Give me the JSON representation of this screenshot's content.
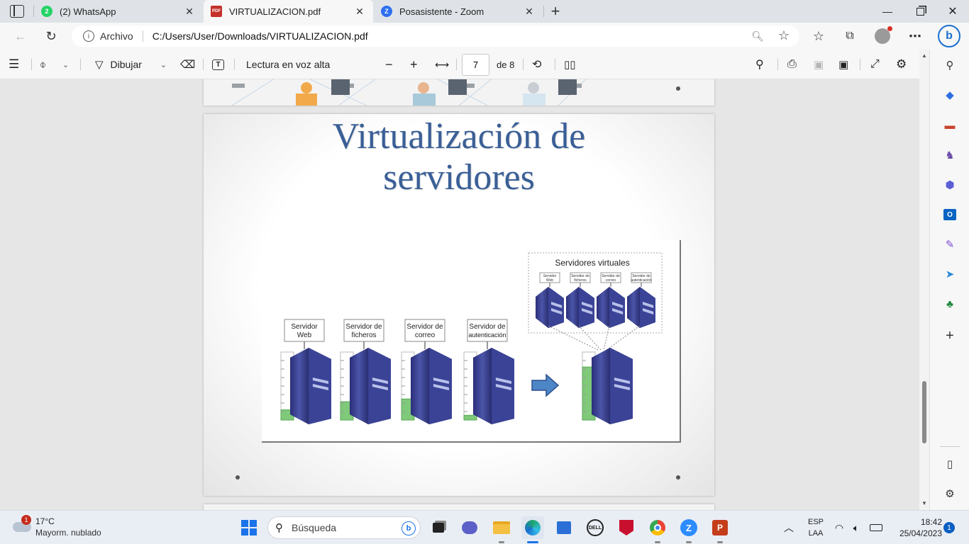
{
  "tabs": [
    {
      "title": "(2) WhatsApp",
      "badge": "2",
      "active": false
    },
    {
      "title": "VIRTUALIZACION.pdf",
      "badge": "PDF",
      "active": true
    },
    {
      "title": "Posasistente - Zoom",
      "badge": "Z",
      "active": false
    }
  ],
  "address": {
    "scheme_label": "Archivo",
    "url": "C:/Users/User/Downloads/VIRTUALIZACION.pdf"
  },
  "pdf_toolbar": {
    "draw_label": "Dibujar",
    "read_aloud_label": "Lectura en voz alta",
    "page_current": "7",
    "page_total_label": "de 8"
  },
  "slide": {
    "title_line1": "Virtualización de",
    "title_line2": "servidores",
    "virtual_group_label": "Servidores virtuales",
    "virtual_servers": [
      "Servidor Web",
      "Servidor de ficheros",
      "Servidor de correo",
      "Servidor de autenticación"
    ],
    "physical_servers": [
      {
        "label_line1": "Servidor",
        "label_line2": "Web",
        "usage": 0.15
      },
      {
        "label_line1": "Servidor de",
        "label_line2": "ficheros",
        "usage": 0.27
      },
      {
        "label_line1": "Servidor de",
        "label_line2": "correo",
        "usage": 0.31
      },
      {
        "label_line1": "Servidor de",
        "label_line2": "autenticación",
        "usage": 0.07
      }
    ],
    "consolidated_usage": 0.78
  },
  "taskbar": {
    "weather_temp": "17°C",
    "weather_desc": "Mayorm. nublado",
    "weather_badge": "1",
    "search_placeholder": "Búsqueda",
    "lang_line1": "ESP",
    "lang_line2": "LAA",
    "time": "18:42",
    "date": "25/04/2023",
    "notif_count": "1"
  },
  "colors": {
    "slide_title": "#3a5f97",
    "accent_edge": "#0c59a4",
    "usage_fill": "#7fc97a"
  }
}
